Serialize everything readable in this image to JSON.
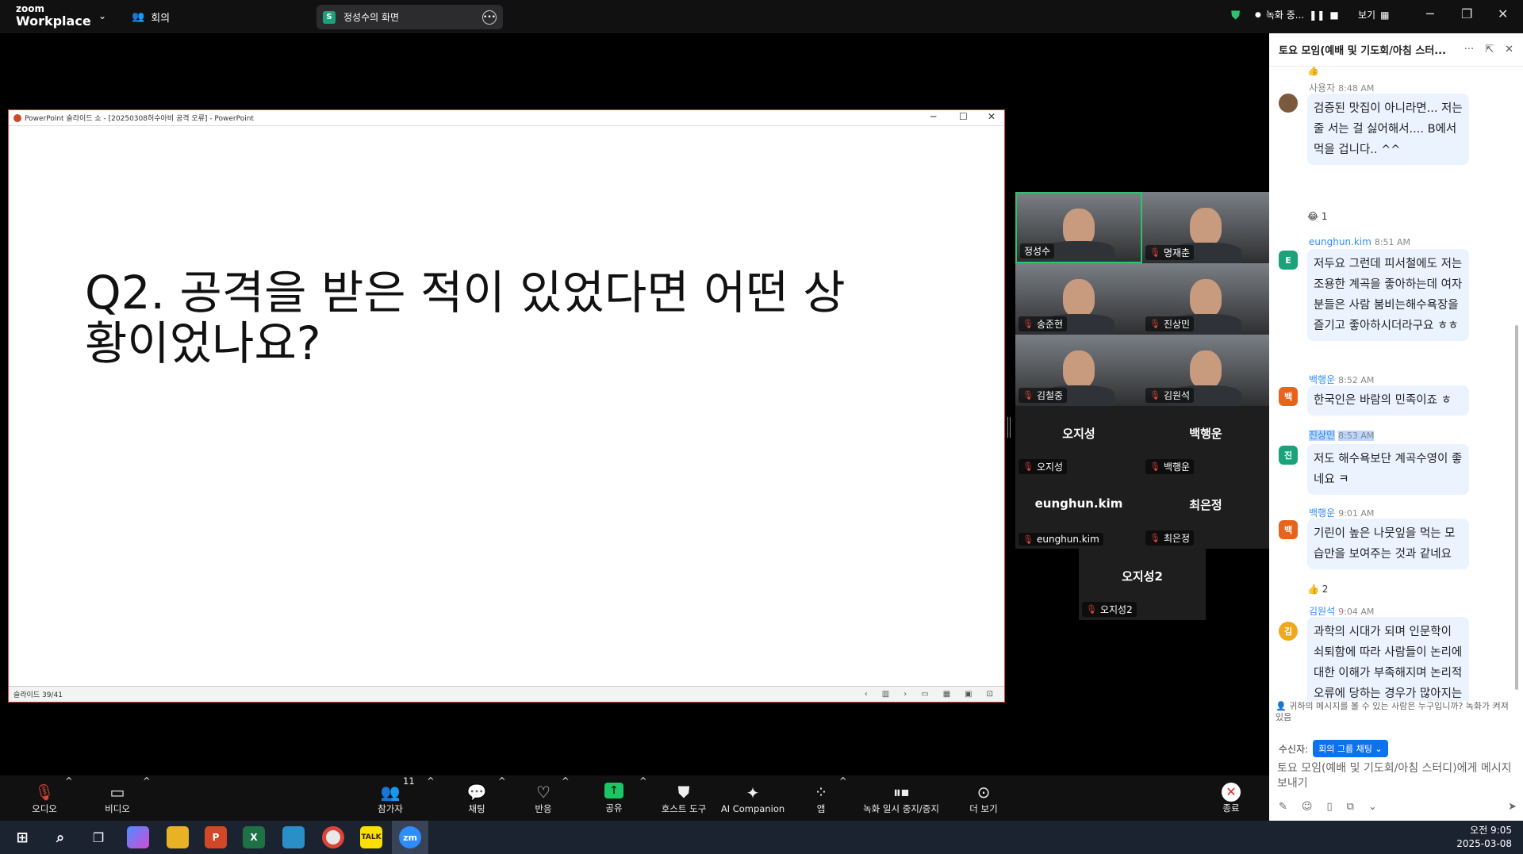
{
  "topbar": {
    "logo_line1": "zoom",
    "logo_line2": "Workplace",
    "meeting_label": "회의",
    "share_badge": "S",
    "share_title": "정성수의 화면",
    "recording": "녹화 중...",
    "view": "보기"
  },
  "ppt": {
    "window_title": "PowerPoint 슬라이드 쇼 - [20250308허수아비 공격 오류] - PowerPoint",
    "slide_text_line1": "Q2. 공격을 받은 적이 있었다면 어떤 상",
    "slide_text_line2": "황이었나요?",
    "slide_counter": "슬라이드 39/41"
  },
  "gallery": [
    {
      "name": "정성수",
      "mic_off": false,
      "active": true,
      "video": true
    },
    {
      "name": "명재춘",
      "mic_off": true,
      "video": true
    },
    {
      "name": "송준현",
      "mic_off": true,
      "video": true
    },
    {
      "name": "진상민",
      "mic_off": true,
      "video": true
    },
    {
      "name": "김철중",
      "mic_off": true,
      "video": true
    },
    {
      "name": "김원석",
      "mic_off": true,
      "video": true
    },
    {
      "name": "오지성",
      "display": "오지성",
      "mic_off": true,
      "video": false
    },
    {
      "name": "백행운",
      "display": "백행운",
      "mic_off": true,
      "video": false
    },
    {
      "name": "eunghun.kim",
      "display": "eunghun.kim",
      "mic_off": true,
      "video": false
    },
    {
      "name": "최은정",
      "display": "최은정",
      "mic_off": true,
      "video": false
    },
    {
      "name": "오지성2",
      "display": "오지성2",
      "mic_off": true,
      "video": false
    }
  ],
  "chat": {
    "title": "토요 모임(예배 및 기도회/아침 스터...",
    "messages": [
      {
        "sender": "사용자",
        "time": "8:48 AM",
        "avatar": "",
        "avatar_color": "#7a5a3a",
        "text": "검증된 맛집이 아니라면... 저는 줄 서는 걸 싫어해서.... B에서 먹을 겁니다.. ^^",
        "reaction": "😂 1"
      },
      {
        "sender": "eunghun.kim",
        "time": "8:51 AM",
        "avatar": "E",
        "avatar_color": "#1aa37a",
        "text": "저두요 그런데 피서철에도 저는 조용한 계곡을 좋아하는데 여자분들은 사람 붐비는해수욕장을 즐기고 좋아하시더라구요 ㅎㅎ"
      },
      {
        "sender": "백행운",
        "time": "8:52 AM",
        "avatar": "백",
        "avatar_color": "#e8631c",
        "text": "한국인은 바람의 민족이죠 ㅎ"
      },
      {
        "sender": "진상민",
        "time": "8:53 AM",
        "avatar": "진",
        "avatar_color": "#1aa37a",
        "text": "저도 해수욕보단 계곡수영이 좋네요 ㅋ"
      },
      {
        "sender": "백행운",
        "time": "9:01 AM",
        "avatar": "백",
        "avatar_color": "#e8631c",
        "text": "기린이 높은 나뭇잎을 먹는 모습만을 보여주는 것과 같네요",
        "reaction": "👍 2"
      },
      {
        "sender": "김원석",
        "time": "9:04 AM",
        "avatar": "김",
        "avatar_color": "#f0a81c",
        "text": "과학의 시대가 되며 인문학이 쇠퇴함에 따라 사람들이 논리에 대한 이해가 부족해지며 논리적 오류에 당하는 경우가 많아지는 것 같습니다."
      }
    ],
    "privacy_note": "귀하의 메시지를 볼 수 있는 사람은 누구입니까? 녹화가 켜져 있음",
    "recipient_label": "수신자:",
    "recipient_value": "회의 그룹 채팅 ⌄",
    "compose_placeholder": "토요 모임(예배 및 기도회/아침 스터디)에게 메시지 보내기"
  },
  "toolbar": {
    "audio": "오디오",
    "video": "비디오",
    "participants": "참가자",
    "participants_count": "11",
    "chat": "채팅",
    "react": "반응",
    "share": "공유",
    "host_tools": "호스트 도구",
    "ai_companion": "AI Companion",
    "apps": "앱",
    "record": "녹화 일시 중지/중지",
    "more": "더 보기",
    "end": "종료"
  },
  "taskbar": {
    "time": "오전 9:05",
    "date": "2025-03-08",
    "talk": "TALK",
    "zm": "zm"
  }
}
